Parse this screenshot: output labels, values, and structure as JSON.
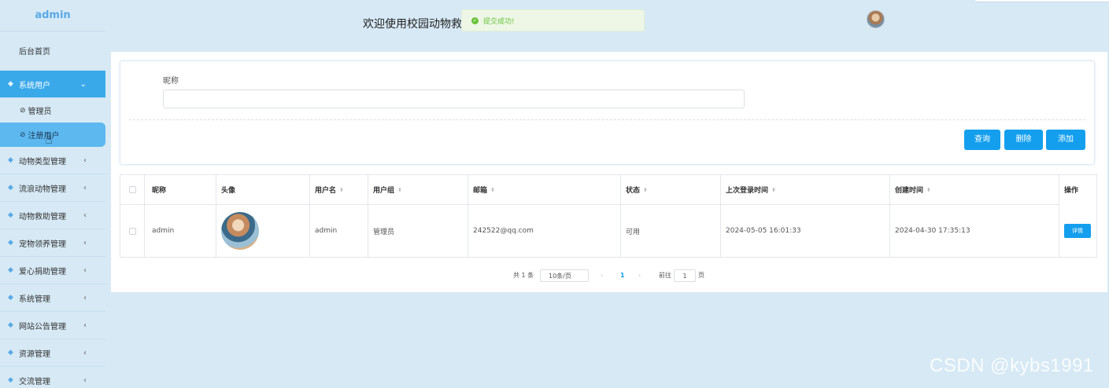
{
  "sidebar": {
    "brand": "admin",
    "home": "后台首页",
    "items": [
      {
        "label": "系统用户",
        "expanded": true,
        "subs": [
          "管理员",
          "注册用户"
        ]
      },
      {
        "label": "动物类型管理"
      },
      {
        "label": "流浪动物管理"
      },
      {
        "label": "动物救助管理"
      },
      {
        "label": "宠物领养管理"
      },
      {
        "label": "爱心捐助管理"
      },
      {
        "label": "系统管理"
      },
      {
        "label": "网站公告管理"
      },
      {
        "label": "资源管理"
      },
      {
        "label": "交流管理"
      }
    ]
  },
  "header": {
    "welcome": "欢迎使用校园动物救助",
    "toast": "提交成功!"
  },
  "filter": {
    "label": "昵称",
    "value": "",
    "buttons": {
      "query": "查询",
      "delete": "删除",
      "add": "添加"
    }
  },
  "table": {
    "columns": [
      "昵称",
      "头像",
      "用户名",
      "用户组",
      "邮箱",
      "状态",
      "上次登录时间",
      "创建时间",
      "操作"
    ],
    "rows": [
      {
        "nickname": "admin",
        "username": "admin",
        "group": "管理员",
        "email": "242522@qq.com",
        "status": "可用",
        "last_login": "2024-05-05 16:01:33",
        "created": "2024-04-30 17:35:13",
        "action": "详情"
      }
    ]
  },
  "pagination": {
    "total": "共 1 条",
    "page_size": "10条/页",
    "current": "1",
    "goto_label": "前往",
    "goto_value": "1",
    "page_unit": "页"
  },
  "watermark": "CSDN @kybs1991",
  "colors": {
    "accent": "#149fee",
    "sidebar_active": "#3aa9ea",
    "background": "#d6e9f5",
    "success": "#67c23a"
  }
}
